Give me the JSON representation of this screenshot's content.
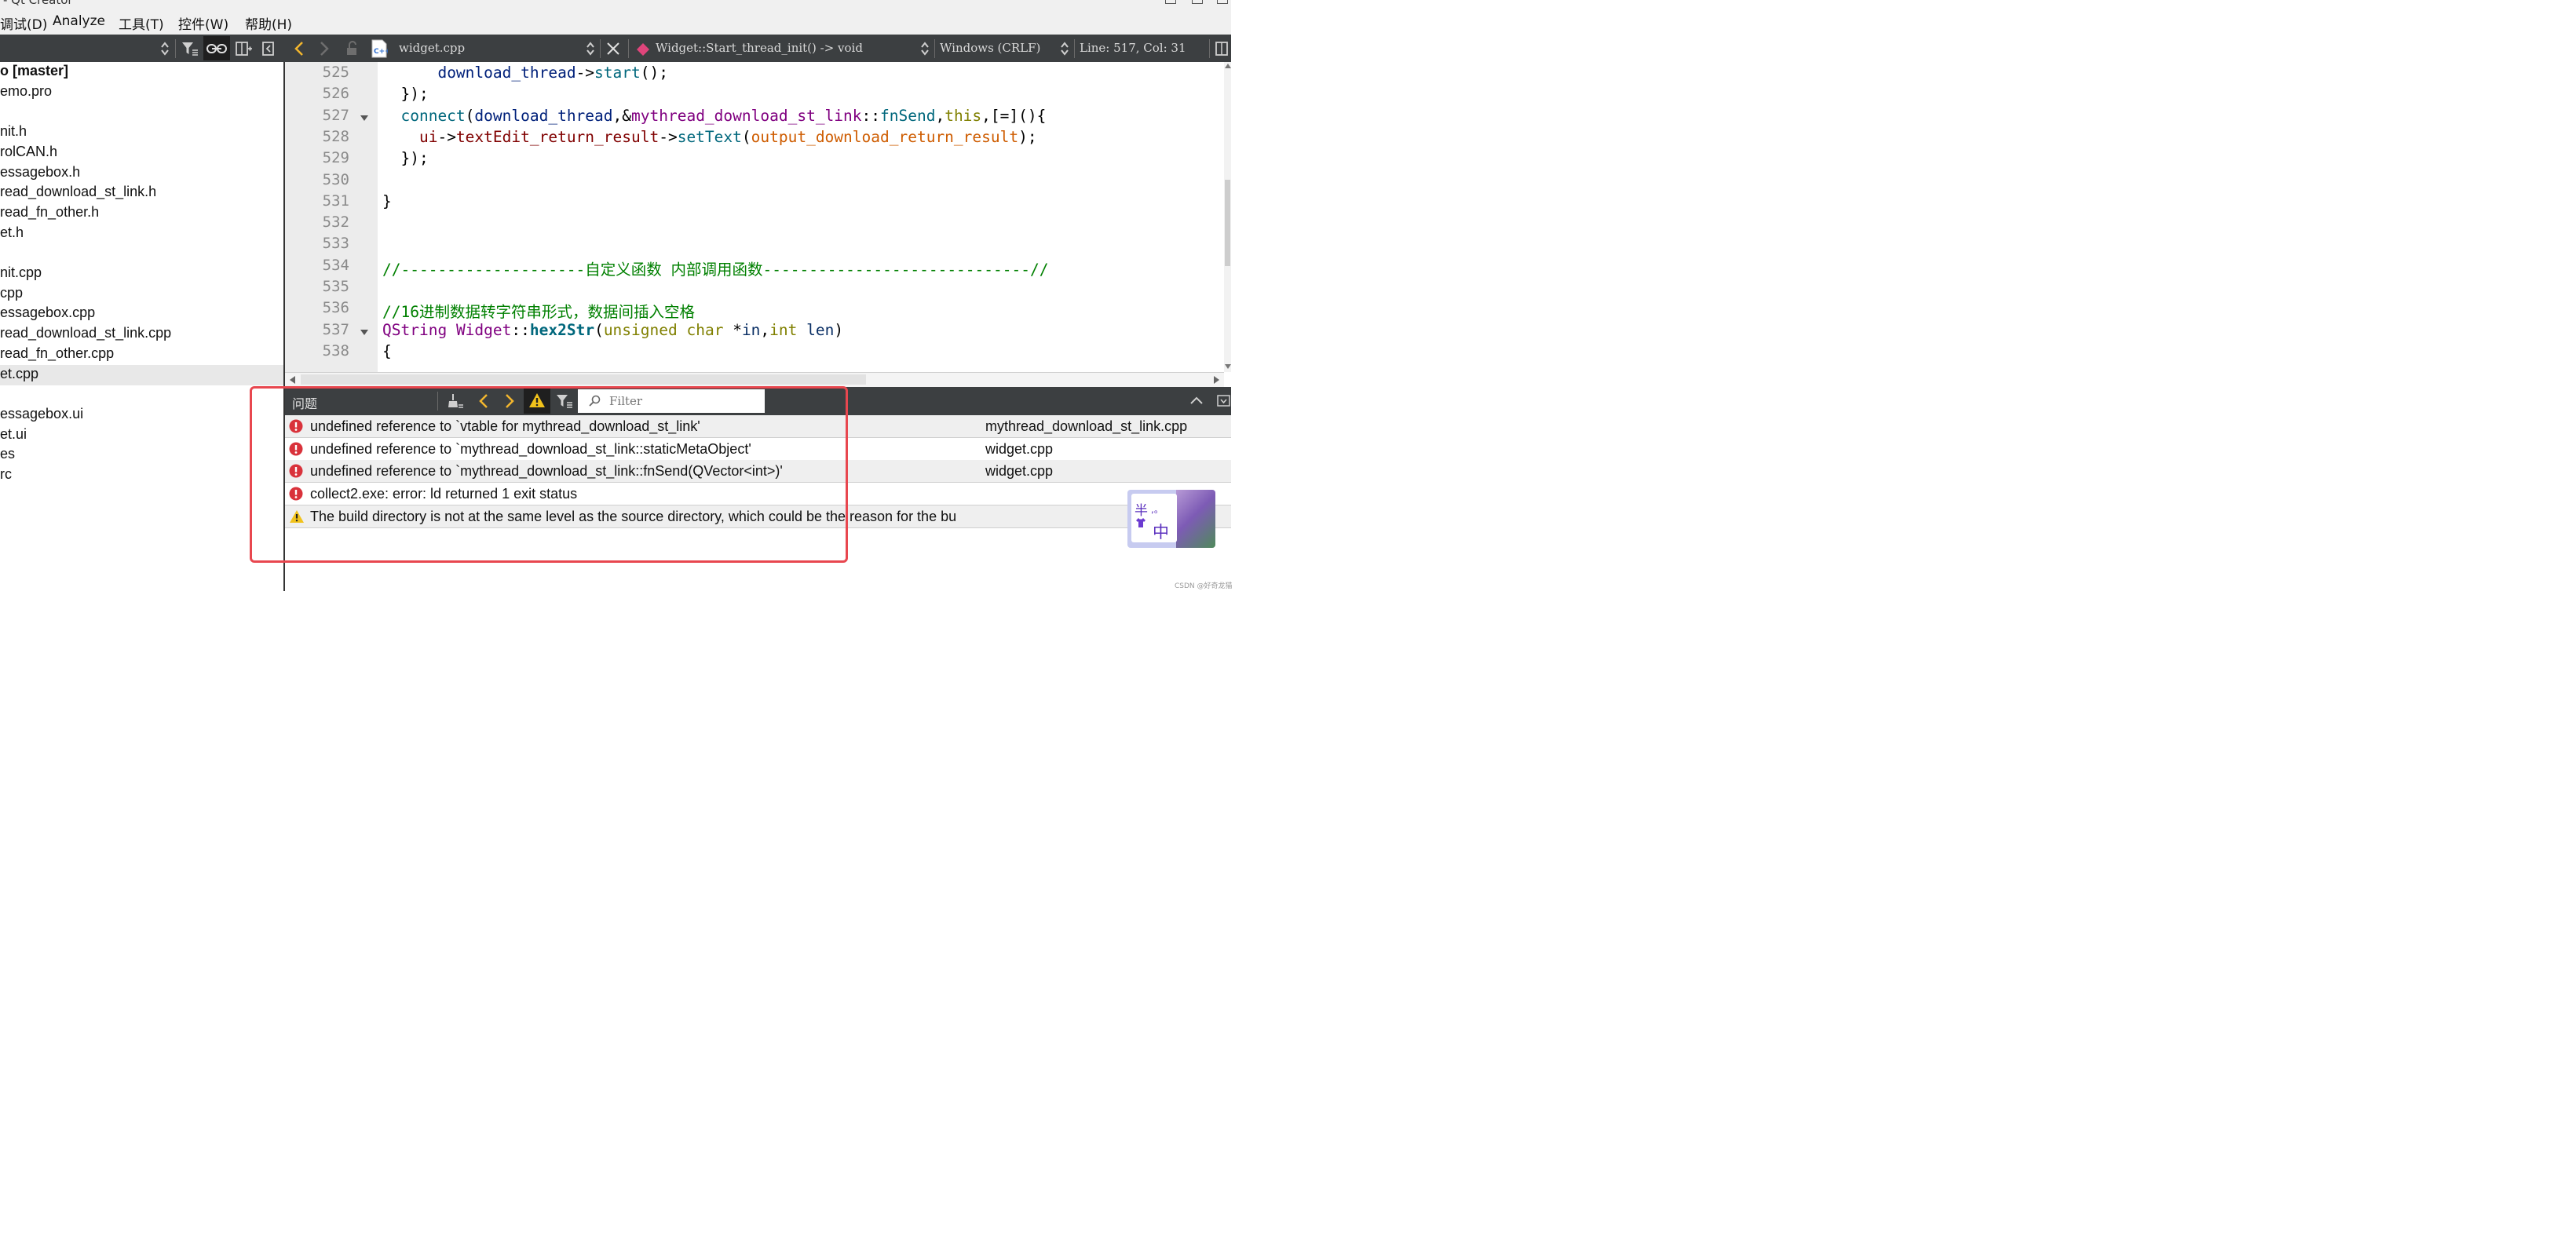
{
  "window": {
    "title": "- Qt Creator"
  },
  "menu": {
    "items": [
      "调试(D)",
      "Analyze",
      "工具(T)",
      "控件(W)",
      "帮助(H)"
    ]
  },
  "editor_toolbar": {
    "file_name": "widget.cpp",
    "function_scope": "Widget::Start_thread_init() -> void",
    "line_ending": "Windows (CRLF)",
    "cursor_position": "Line: 517, Col: 31"
  },
  "project_tree": {
    "items": [
      {
        "label": "o [master]",
        "bold": true
      },
      {
        "label": "emo.pro"
      },
      {
        "label": ""
      },
      {
        "label": "nit.h"
      },
      {
        "label": "rolCAN.h"
      },
      {
        "label": "essagebox.h"
      },
      {
        "label": "read_download_st_link.h"
      },
      {
        "label": "read_fn_other.h"
      },
      {
        "label": "et.h"
      },
      {
        "label": ""
      },
      {
        "label": "nit.cpp"
      },
      {
        "label": "cpp"
      },
      {
        "label": "essagebox.cpp"
      },
      {
        "label": "read_download_st_link.cpp"
      },
      {
        "label": "read_fn_other.cpp"
      },
      {
        "label": "et.cpp",
        "selected": true
      },
      {
        "label": ""
      },
      {
        "label": "essagebox.ui"
      },
      {
        "label": "et.ui"
      },
      {
        "label": "es"
      },
      {
        "label": "rc"
      }
    ]
  },
  "code": {
    "lines": [
      {
        "num": "525",
        "fold": false,
        "segments": [
          [
            "      ",
            ""
          ],
          [
            "download_thread",
            "#00207a"
          ],
          [
            "->",
            ""
          ],
          [
            "start",
            "#00677c"
          ],
          [
            "();",
            ""
          ]
        ]
      },
      {
        "num": "526",
        "fold": false,
        "segments": [
          [
            "  });",
            ""
          ]
        ]
      },
      {
        "num": "527",
        "fold": true,
        "segments": [
          [
            "  ",
            ""
          ],
          [
            "connect",
            "#00677c"
          ],
          [
            "(",
            ""
          ],
          [
            "download_thread",
            "#00207a"
          ],
          [
            ",&",
            ""
          ],
          [
            "mythread_download_st_link",
            "#800080"
          ],
          [
            "::",
            ""
          ],
          [
            "fnSend",
            "#00677c"
          ],
          [
            ",",
            ""
          ],
          [
            "this",
            "#808000"
          ],
          [
            ",[=](){",
            ""
          ]
        ]
      },
      {
        "num": "528",
        "fold": false,
        "segments": [
          [
            "    ",
            ""
          ],
          [
            "ui",
            "#800000"
          ],
          [
            "->",
            ""
          ],
          [
            "textEdit_return_result",
            "#800000"
          ],
          [
            "->",
            ""
          ],
          [
            "setText",
            "#00677c"
          ],
          [
            "(",
            ""
          ],
          [
            "output_download_return_result",
            "#ce5c00"
          ],
          [
            ");",
            ""
          ]
        ]
      },
      {
        "num": "529",
        "fold": false,
        "segments": [
          [
            "  });",
            ""
          ]
        ]
      },
      {
        "num": "530",
        "fold": false,
        "segments": [
          [
            "",
            ""
          ]
        ]
      },
      {
        "num": "531",
        "fold": false,
        "segments": [
          [
            "}",
            ""
          ]
        ]
      },
      {
        "num": "532",
        "fold": false,
        "segments": [
          [
            "",
            ""
          ]
        ]
      },
      {
        "num": "533",
        "fold": false,
        "segments": [
          [
            "",
            ""
          ]
        ]
      },
      {
        "num": "534",
        "fold": false,
        "segments": [
          [
            "//--------------------自定义函数 内部调用函数-----------------------------//",
            "#008000"
          ]
        ]
      },
      {
        "num": "535",
        "fold": false,
        "segments": [
          [
            "",
            ""
          ]
        ]
      },
      {
        "num": "536",
        "fold": false,
        "segments": [
          [
            "//16进制数据转字符串形式，数据间插入空格",
            "#008000"
          ]
        ]
      },
      {
        "num": "537",
        "fold": true,
        "segments": [
          [
            "QString",
            "#800080"
          ],
          [
            " ",
            ""
          ],
          [
            "Widget",
            "#800080"
          ],
          [
            "::",
            ""
          ],
          [
            "hex2Str",
            "#00677c",
            "bold"
          ],
          [
            "(",
            ""
          ],
          [
            "unsigned",
            "#808000"
          ],
          [
            " ",
            ""
          ],
          [
            "char",
            "#808000"
          ],
          [
            " *",
            ""
          ],
          [
            "in",
            "#092e64"
          ],
          [
            ",",
            ""
          ],
          [
            "int",
            "#808000"
          ],
          [
            " ",
            ""
          ],
          [
            "len",
            "#092e64"
          ],
          [
            ")",
            ""
          ]
        ]
      },
      {
        "num": "538",
        "fold": false,
        "segments": [
          [
            "{",
            ""
          ]
        ]
      }
    ]
  },
  "issues": {
    "title": "问题",
    "filter_placeholder": "Filter",
    "rows": [
      {
        "severity": "error",
        "message": "undefined reference to `vtable for mythread_download_st_link'",
        "file": "mythread_download_st_link.cpp"
      },
      {
        "severity": "error",
        "message": "undefined reference to `mythread_download_st_link::staticMetaObject'",
        "file": "widget.cpp"
      },
      {
        "severity": "error",
        "message": "undefined reference to `mythread_download_st_link::fnSend(QVector<int>)'",
        "file": "widget.cpp"
      },
      {
        "severity": "error",
        "message": "collect2.exe: error: ld returned 1 exit status",
        "file": ""
      },
      {
        "severity": "warning",
        "message": "The build directory is not at the same level as the source directory, which could be the reason for the bu",
        "file": ""
      }
    ]
  },
  "ime": {
    "char_top": "半",
    "punct": ",。",
    "char_main": "中"
  },
  "watermark": "CSDN @好奇龙猫",
  "colors": {
    "toolbar_bg": "#3c3f41",
    "error_red": "#d9323b",
    "warning_yellow": "#f1c21b",
    "highlight_box": "#e8474f",
    "comment_green": "#008000"
  }
}
